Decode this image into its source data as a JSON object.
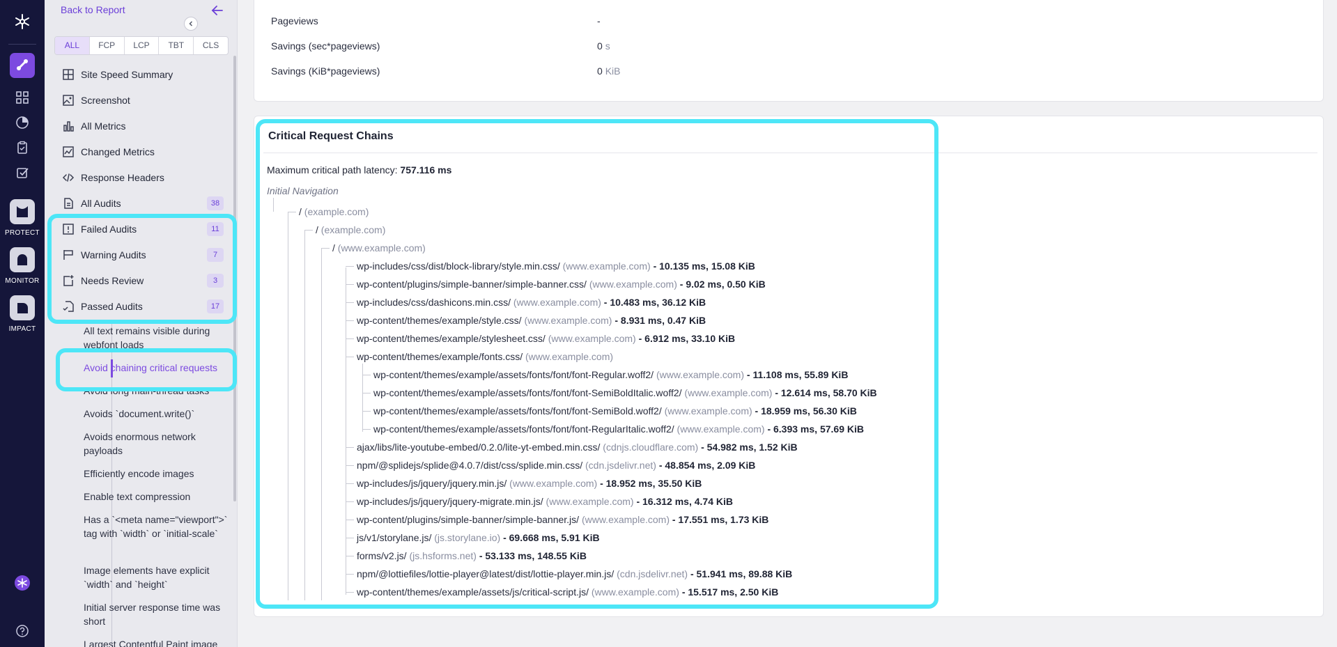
{
  "rail": {
    "logo_icon": "asterisk-logo-icon",
    "items": [
      {
        "icon": "chain-link-icon",
        "active": true
      },
      {
        "icon": "grid-icon"
      },
      {
        "icon": "gauge-icon"
      },
      {
        "icon": "clipboard-icon"
      },
      {
        "icon": "checkbox-icon"
      }
    ],
    "products": [
      {
        "label": "PROTECT"
      },
      {
        "label": "MONITOR"
      },
      {
        "label": "IMPACT"
      }
    ],
    "bottom": [
      {
        "icon": "brand-badge-icon"
      },
      {
        "icon": "help-icon"
      }
    ]
  },
  "sidebar": {
    "back_label": "Back to Report",
    "tabs": [
      {
        "label": "ALL",
        "active": true
      },
      {
        "label": "FCP"
      },
      {
        "label": "LCP"
      },
      {
        "label": "TBT"
      },
      {
        "label": "CLS"
      }
    ],
    "nav": [
      {
        "label": "Site Speed Summary",
        "icon": "table-icon"
      },
      {
        "label": "Screenshot",
        "icon": "image-icon"
      },
      {
        "label": "All Metrics",
        "icon": "bar-chart-icon"
      },
      {
        "label": "Changed Metrics",
        "icon": "line-chart-icon"
      },
      {
        "label": "Response Headers",
        "icon": "code-icon"
      },
      {
        "label": "All Audits",
        "icon": "document-icon",
        "badge": "38"
      },
      {
        "label": "Failed Audits",
        "icon": "alert-square-icon",
        "badge": "11"
      },
      {
        "label": "Warning Audits",
        "icon": "flag-icon",
        "badge": "7"
      },
      {
        "label": "Needs Review",
        "icon": "review-icon",
        "badge": "3"
      },
      {
        "label": "Passed Audits",
        "icon": "passed-doc-icon",
        "badge": "17"
      }
    ],
    "audits": [
      {
        "label": "All text remains visible during webfont loads"
      },
      {
        "label": "Avoid chaining critical requests",
        "active": true
      },
      {
        "label": "Avoid long main-thread tasks"
      },
      {
        "label": "Avoids `document.write()`"
      },
      {
        "label": "Avoids enormous network payloads"
      },
      {
        "label": "Efficiently encode images"
      },
      {
        "label": "Enable text compression"
      },
      {
        "label": "Has a `<meta name=\"viewport\">` tag with `width` or `initial-scale`"
      },
      {
        "label": "Image elements have explicit `width` and `height`"
      },
      {
        "label": "Initial server response time was short"
      },
      {
        "label": "Largest Contentful Paint image"
      }
    ]
  },
  "summary": {
    "rows": [
      {
        "label": "Pageviews",
        "value": "-",
        "unit": ""
      },
      {
        "label": "Savings (sec*pageviews)",
        "value": "0",
        "unit": "s"
      },
      {
        "label": "Savings (KiB*pageviews)",
        "value": "0",
        "unit": "KiB"
      }
    ]
  },
  "chains": {
    "title": "Critical Request Chains",
    "latency_label": "Maximum critical path latency:",
    "latency_value": "757.116 ms",
    "initial_navigation": "Initial Navigation",
    "nodes": [
      {
        "path": "/",
        "host": "(example.com)",
        "stat": ""
      },
      {
        "path": "/",
        "host": "(example.com)",
        "stat": ""
      },
      {
        "path": "/",
        "host": "(www.example.com)",
        "stat": ""
      },
      {
        "path": "wp-includes/css/dist/block-library/style.min.css/",
        "host": "(www.example.com)",
        "stat": "- 10.135 ms, 15.08 KiB"
      },
      {
        "path": "wp-content/plugins/simple-banner/simple-banner.css/",
        "host": "(www.example.com)",
        "stat": "- 9.02 ms, 0.50 KiB"
      },
      {
        "path": "wp-includes/css/dashicons.min.css/",
        "host": "(www.example.com)",
        "stat": "- 10.483 ms, 36.12 KiB"
      },
      {
        "path": "wp-content/themes/example/style.css/",
        "host": "(www.example.com)",
        "stat": "- 8.931 ms, 0.47 KiB"
      },
      {
        "path": "wp-content/themes/example/stylesheet.css/",
        "host": "(www.example.com)",
        "stat": "- 6.912 ms, 33.10 KiB"
      },
      {
        "path": "wp-content/themes/example/fonts.css/",
        "host": "(www.example.com)",
        "stat": ""
      },
      {
        "path": "wp-content/themes/example/assets/fonts/font/font-Regular.woff2/",
        "host": "(www.example.com)",
        "stat": "- 11.108 ms, 55.89 KiB"
      },
      {
        "path": "wp-content/themes/example/assets/fonts/font/font-SemiBoldItalic.woff2/",
        "host": "(www.example.com)",
        "stat": "- 12.614 ms, 58.70 KiB"
      },
      {
        "path": "wp-content/themes/example/assets/fonts/font/font-SemiBold.woff2/",
        "host": "(www.example.com)",
        "stat": "- 18.959 ms, 56.30 KiB"
      },
      {
        "path": "wp-content/themes/example/assets/fonts/font/font-RegularItalic.woff2/",
        "host": "(www.example.com)",
        "stat": "- 6.393 ms, 57.69 KiB"
      },
      {
        "path": "ajax/libs/lite-youtube-embed/0.2.0/lite-yt-embed.min.css/",
        "host": "(cdnjs.cloudflare.com)",
        "stat": "- 54.982 ms, 1.52 KiB"
      },
      {
        "path": "npm/@splidejs/splide@4.0.7/dist/css/splide.min.css/",
        "host": "(cdn.jsdelivr.net)",
        "stat": "- 48.854 ms, 2.09 KiB"
      },
      {
        "path": "wp-includes/js/jquery/jquery.min.js/",
        "host": "(www.example.com)",
        "stat": "- 18.952 ms, 35.50 KiB"
      },
      {
        "path": "wp-includes/js/jquery/jquery-migrate.min.js/",
        "host": "(www.example.com)",
        "stat": "- 16.312 ms, 4.74 KiB"
      },
      {
        "path": "wp-content/plugins/simple-banner/simple-banner.js/",
        "host": "(www.example.com)",
        "stat": "- 17.551 ms, 1.73 KiB"
      },
      {
        "path": "js/v1/storylane.js/",
        "host": "(js.storylane.io)",
        "stat": "- 69.668 ms, 5.91 KiB"
      },
      {
        "path": "forms/v2.js/",
        "host": "(js.hsforms.net)",
        "stat": "- 53.133 ms, 148.55 KiB"
      },
      {
        "path": "npm/@lottiefiles/lottie-player@latest/dist/lottie-player.min.js/",
        "host": "(cdn.jsdelivr.net)",
        "stat": "- 51.941 ms, 89.88 KiB"
      },
      {
        "path": "wp-content/themes/example/assets/js/critical-script.js/",
        "host": "(www.example.com)",
        "stat": "- 15.517 ms, 2.50 KiB"
      }
    ]
  },
  "colors": {
    "accent": "#7c4ae0",
    "rail_bg": "#15163a",
    "highlight": "#4de6f7"
  }
}
